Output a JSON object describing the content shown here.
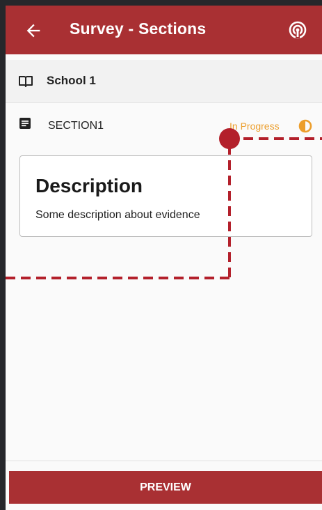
{
  "header": {
    "title": "Survey - Sections",
    "background": "#a93033"
  },
  "school": {
    "name": "School 1",
    "icon": "book-open-icon"
  },
  "section": {
    "name": "SECTION1",
    "status": "In Progress",
    "status_color": "#ec9e2c",
    "icon": "document-icon",
    "status_icon": "half-circle-icon"
  },
  "card": {
    "title": "Description",
    "description": "Some description about evidence"
  },
  "footer": {
    "preview_label": "PREVIEW"
  },
  "annotation": {
    "color": "#b3202b"
  }
}
